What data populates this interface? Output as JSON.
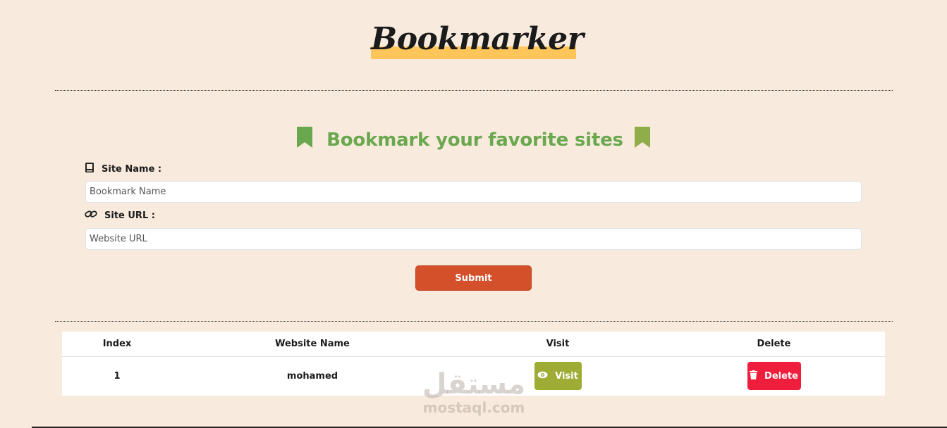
{
  "header": {
    "logo_text": "Bookmarker"
  },
  "form": {
    "title": "Bookmark your favorite sites",
    "site_name_label": "Site Name :",
    "site_name_placeholder": "Bookmark Name",
    "site_url_label": "Site URL :",
    "site_url_placeholder": "Website URL",
    "submit_label": "Submit"
  },
  "table": {
    "headers": [
      "Index",
      "Website Name",
      "Visit",
      "Delete"
    ],
    "rows": [
      {
        "index": "1",
        "name": "mohamed",
        "visit_label": "Visit",
        "delete_label": "Delete"
      }
    ]
  },
  "watermark": {
    "arabic": "مستقل",
    "latin": "mostaql.com"
  },
  "colors": {
    "background": "#f8ebdd",
    "logo_highlight": "#fec55a",
    "title_green": "#6aa84f",
    "submit": "#d4502b",
    "visit": "#9eac36",
    "delete": "#ef1e3d"
  },
  "icons": {
    "title_left": "bookmark-icon",
    "title_right": "bookmark-icon",
    "site_name": "book-icon",
    "site_url": "link-icon",
    "visit": "eye-icon",
    "delete": "trash-icon"
  }
}
